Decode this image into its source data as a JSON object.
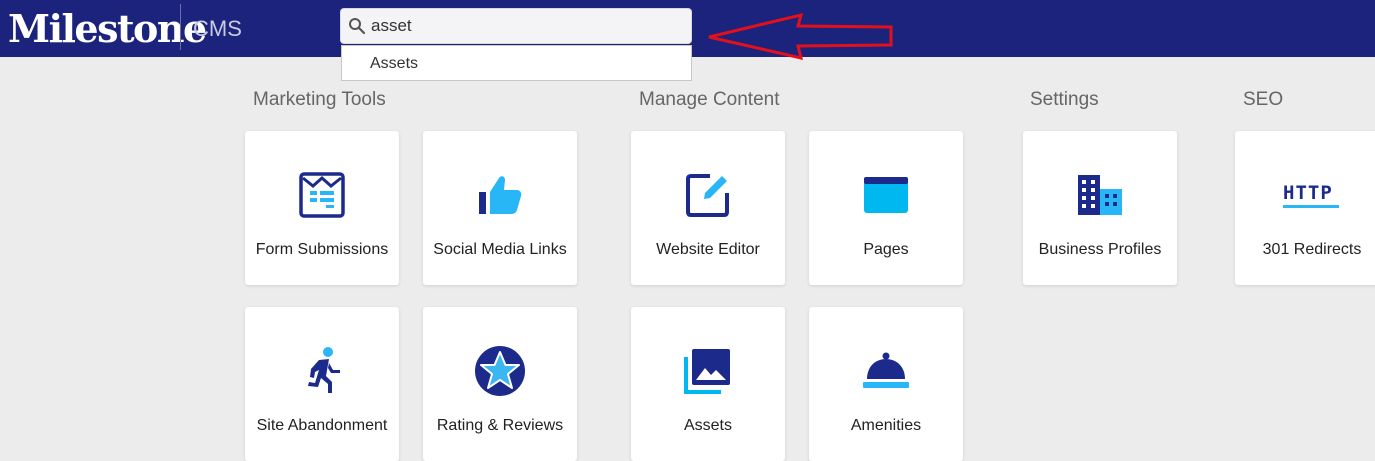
{
  "header": {
    "logo": "Milestone",
    "product": "CMS",
    "search": {
      "value": "asset",
      "placeholder": ""
    },
    "suggestions": [
      "Assets"
    ]
  },
  "sections": [
    {
      "title": "Marketing Tools"
    },
    {
      "title": "Manage Content"
    },
    {
      "title": "Settings"
    },
    {
      "title": "SEO"
    }
  ],
  "cards": {
    "form_submissions": "Form Submissions",
    "social_media_links": "Social Media Links",
    "website_editor": "Website Editor",
    "pages": "Pages",
    "business_profiles": "Business Profiles",
    "redirects": "301 Redirects",
    "site_abandonment": "Site Abandonment",
    "rating_reviews": "Rating & Reviews",
    "assets": "Assets",
    "amenities": "Amenities"
  },
  "icons": {
    "redirects_icon_text": "HTTP"
  },
  "colors": {
    "header_bg": "#1b237c",
    "icon_dark": "#1c2a8c",
    "icon_light": "#29b6f6",
    "arrow": "#e3101c"
  }
}
